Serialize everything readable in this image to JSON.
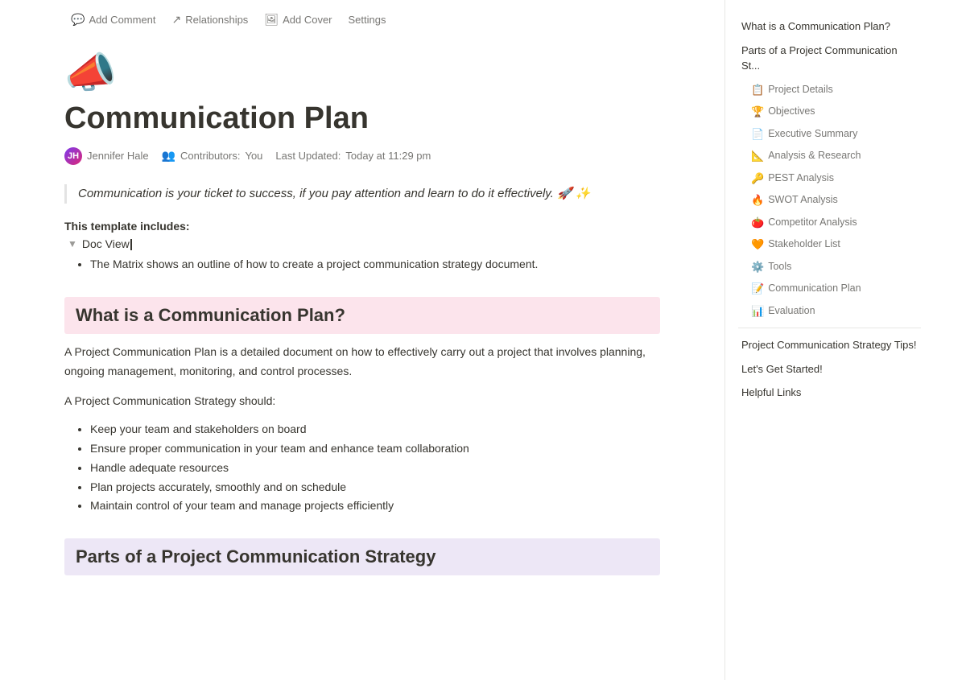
{
  "toolbar": {
    "add_comment_label": "Add Comment",
    "relationships_label": "Relationships",
    "add_cover_label": "Add Cover",
    "settings_label": "Settings"
  },
  "page": {
    "icon": "📣",
    "title": "Communication Plan",
    "author_name": "Jennifer Hale",
    "contributors_label": "Contributors:",
    "contributors_value": "You",
    "last_updated_label": "Last Updated:",
    "last_updated_value": "Today at 11:29 pm"
  },
  "quote": {
    "text": "Communication is your ticket to success, if you pay attention and learn to do it effectively. 🚀 ✨"
  },
  "template": {
    "includes_label": "This template includes:",
    "doc_view_label": "Doc View",
    "bullet": "The Matrix shows an outline of how to create a project communication strategy document."
  },
  "section1": {
    "heading": "What is a Communication Plan?",
    "para1": "A Project Communication Plan is a detailed document on how to effectively carry out a project that involves planning, ongoing management, monitoring, and control processes.",
    "should_label": "A Project Communication Strategy should:",
    "bullets": [
      "Keep your team and stakeholders on board",
      "Ensure proper communication in your team and enhance team collaboration",
      "Handle adequate resources",
      "Plan projects accurately, smoothly and on schedule",
      "Maintain control of your team and manage projects efficiently"
    ]
  },
  "section2": {
    "heading": "Parts of a Project Communication Strategy"
  },
  "toc": {
    "items_main": [
      {
        "id": "toc-what",
        "label": "What is a Communication Plan?"
      },
      {
        "id": "toc-parts",
        "label": "Parts of a Project Communication St..."
      }
    ],
    "items_sub": [
      {
        "id": "toc-project-details",
        "emoji": "📋",
        "label": "Project Details"
      },
      {
        "id": "toc-objectives",
        "emoji": "🏆",
        "label": "Objectives"
      },
      {
        "id": "toc-exec-summary",
        "emoji": "📄",
        "label": "Executive Summary"
      },
      {
        "id": "toc-analysis",
        "emoji": "📐",
        "label": "Analysis & Research"
      },
      {
        "id": "toc-pest",
        "emoji": "🔑",
        "label": "PEST Analysis"
      },
      {
        "id": "toc-swot",
        "emoji": "🔥",
        "label": "SWOT Analysis"
      },
      {
        "id": "toc-competitor",
        "emoji": "🍅",
        "label": "Competitor Analysis"
      },
      {
        "id": "toc-stakeholder",
        "emoji": "🧡",
        "label": "Stakeholder List"
      },
      {
        "id": "toc-tools",
        "emoji": "⚙️",
        "label": "Tools"
      },
      {
        "id": "toc-comm-plan",
        "emoji": "📝",
        "label": "Communication Plan"
      },
      {
        "id": "toc-evaluation",
        "emoji": "📊",
        "label": "Evaluation"
      }
    ],
    "items_footer": [
      {
        "id": "toc-tips",
        "label": "Project Communication Strategy Tips!"
      },
      {
        "id": "toc-started",
        "label": "Let's Get Started!"
      },
      {
        "id": "toc-links",
        "label": "Helpful Links"
      }
    ]
  },
  "colors": {
    "accent_pink": "#fce4ec",
    "accent_purple": "#ede7f6",
    "border": "#e7e7e5",
    "muted_text": "#787774",
    "sidebar_text": "#37352f"
  }
}
